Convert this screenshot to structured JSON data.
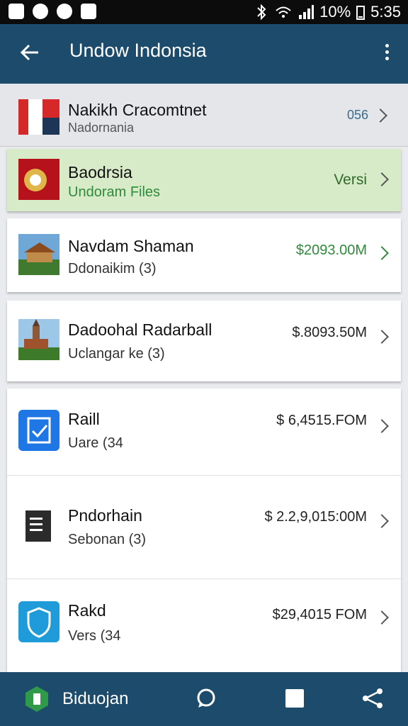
{
  "status": {
    "battery": "10%",
    "time": "5:35"
  },
  "appbar": {
    "title": "Undow Indonsia"
  },
  "items": [
    {
      "title": "Nakikh Cracomtnet",
      "subtitle": "Nadornania",
      "value": "056"
    },
    {
      "title": "Baodrsia",
      "subtitle": "Undoram Files",
      "value": "Versi"
    },
    {
      "title": "Navdam Shaman",
      "subtitle": "Ddonaikim (3)",
      "value": "$2093.00M"
    },
    {
      "title": "Dadoohal Radarball",
      "subtitle": "Uclangar ke (3)",
      "value": "$.8093.50M"
    },
    {
      "title": "Raill",
      "subtitle": "Uare (34",
      "value": "$ 6,4515.FOM"
    },
    {
      "title": "Pndorhain",
      "subtitle": "Sebonan (3)",
      "value": "$ 2.2,9,015:00M"
    },
    {
      "title": "Rakd",
      "subtitle": "Vers (34",
      "value": "$29,4015 FOM"
    }
  ],
  "navbar": {
    "label": "Biduojan"
  },
  "colors": {
    "appbar": "#1c4b6b",
    "highlight": "#d8ebc9",
    "accent_green": "#2e8b3a",
    "icon_blue": "#1f77e6"
  }
}
